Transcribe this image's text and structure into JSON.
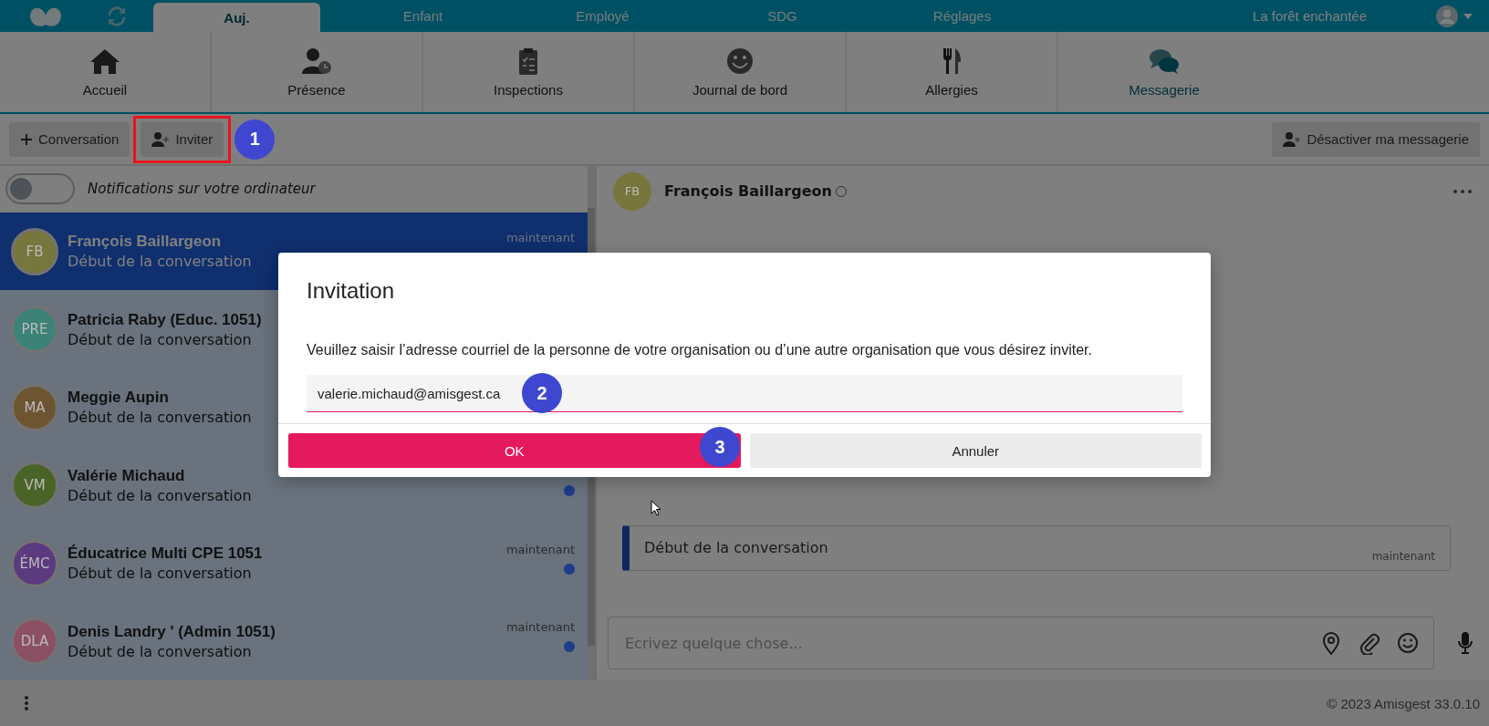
{
  "top_nav": {
    "tabs": [
      {
        "label": "Auj.",
        "selected": true
      },
      {
        "label": "Enfant",
        "selected": false
      },
      {
        "label": "Employé",
        "selected": false
      },
      {
        "label": "SDG",
        "selected": false
      },
      {
        "label": "Réglages",
        "selected": false
      }
    ],
    "organization": "La forêt enchantée"
  },
  "modules": [
    {
      "label": "Accueil",
      "selected": false
    },
    {
      "label": "Présence",
      "selected": false
    },
    {
      "label": "Inspections",
      "selected": false
    },
    {
      "label": "Journal de bord",
      "selected": false
    },
    {
      "label": "Allergies",
      "selected": false
    },
    {
      "label": "Messagerie",
      "selected": true
    }
  ],
  "toolbar": {
    "buttons": [
      {
        "label": "Conversation",
        "highlighted": false
      },
      {
        "label": "Inviter",
        "highlighted": true
      }
    ],
    "disable_button": "Désactiver ma messagerie"
  },
  "notifications": {
    "label": "Notifications sur votre ordinateur",
    "on": false
  },
  "conversations": [
    {
      "initials": "FB",
      "color": "#77763c",
      "name": "François Baillargeon",
      "preview": "Début de la conversation",
      "time": "maintenant",
      "selected": true,
      "unread": false
    },
    {
      "initials": "PRE",
      "color": "#3c8277",
      "name": "Patricia Raby (Educ. 1051)",
      "preview": "Début de la conversation",
      "selected": false,
      "unread": false
    },
    {
      "initials": "MA",
      "color": "#6e5532",
      "name": "Meggie Aupin",
      "preview": "Début de la conversation",
      "selected": false,
      "unread": false
    },
    {
      "initials": "VM",
      "color": "#4a6428",
      "name": "Valérie Michaud",
      "preview": "Début de la conversation",
      "selected": false,
      "unread": true
    },
    {
      "initials": "ÉMC",
      "color": "#5c3a80",
      "name": "Éducatrice Multi CPE 1051",
      "preview": "Début de la conversation",
      "time": "maintenant",
      "selected": false,
      "unread": true
    },
    {
      "initials": "DLA",
      "color": "#8c5064",
      "name": "Denis Landry ' (Admin 1051)",
      "preview": "Début de la conversation",
      "time": "maintenant",
      "selected": false,
      "unread": true
    }
  ],
  "chat": {
    "contact": {
      "initials": "FB",
      "color": "#77763c",
      "name": "François Baillargeon",
      "online": false
    },
    "messages": [
      {
        "text": "Début de la conversation",
        "time": "maintenant"
      }
    ],
    "composer": {
      "placeholder": "Ecrivez quelque chose..."
    }
  },
  "footer": {
    "copyright": "© 2023 Amisgest 33.0.10"
  },
  "dialog": {
    "title": "Invitation",
    "message": "Veuillez saisir l’adresse courriel de la personne de votre organisation ou d’une autre organisation que vous désirez inviter.",
    "email": "valerie.michaud@amisgest.ca",
    "buttons": [
      {
        "label": "OK",
        "kind": "primary"
      },
      {
        "label": "Annuler",
        "kind": "secondary"
      }
    ]
  },
  "annotations": [
    {
      "label": "1"
    },
    {
      "label": "2"
    },
    {
      "label": "3"
    }
  ]
}
